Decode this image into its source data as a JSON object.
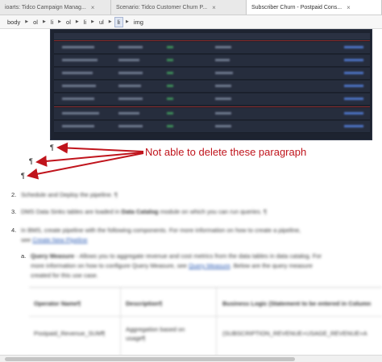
{
  "tabs": [
    {
      "label": "ioarts: Tidco Campaign Manag...",
      "active": false
    },
    {
      "label": "Scenario: Tidco Customer Churn P...",
      "active": false
    },
    {
      "label": "Subscriber Churn - Postpaid Cons...",
      "active": true
    }
  ],
  "breadcrumb": [
    "body",
    "ol",
    "li",
    "ol",
    "li",
    "ul",
    "li",
    "img"
  ],
  "breadcrumb_selected_index": 6,
  "pilcrow": "¶",
  "annotation": "Not able to delete these paragraph",
  "annotation_color": "#c0141c",
  "steps": [
    {
      "number": "2.",
      "text": "Schedule and Deploy the pipeline. ¶"
    },
    {
      "number": "3.",
      "text_a": "DMS Data Sinks tables are loaded in ",
      "text_b": "Data Catalog",
      "text_c": " module on which you can run queries. ¶"
    },
    {
      "number": "4.",
      "line1": "In BMS, create pipeline with the following components. For more information on how to create a pipeline,",
      "line2_a": "see ",
      "line2_link": "Create New Pipeline"
    }
  ],
  "substep": {
    "letter": "a.",
    "label": "Query Measure",
    "line1": " - Allows you to aggregate revenue and cost metrics from the data tables in data catalog. For",
    "line2_a": "more information on how to configure Query Measure, see ",
    "line2_link": "Query Measure",
    "line2_b": ". Below are the query measure",
    "line3": "created for this use case."
  },
  "table": {
    "headers": [
      "Operator Name¶",
      "Description¶",
      "Business Logic (Statement to be entered in Column"
    ],
    "rows": [
      {
        "name": "Postpaid_Revenue_SUM¶",
        "desc1": "Aggregation based on",
        "desc2": "usage¶",
        "logic": "(SUBSCRIPTION_REVENUE+USAGE_REVENUE+A"
      }
    ]
  }
}
